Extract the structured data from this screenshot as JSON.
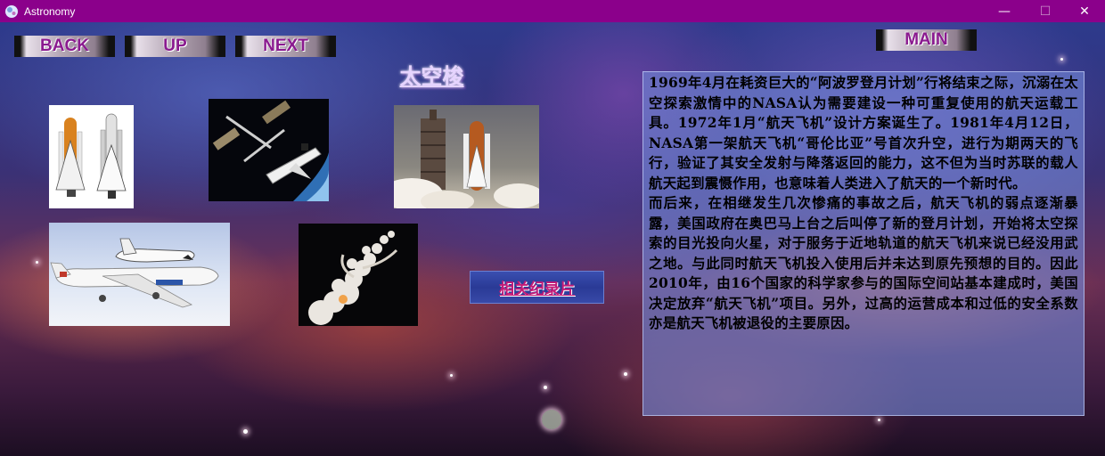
{
  "window": {
    "title": "Astronomy",
    "controls": {
      "minimize": "—",
      "maximize": "☐",
      "close": "✕"
    }
  },
  "nav": {
    "back": "BACK",
    "up": "UP",
    "next": "NEXT",
    "main": "MAIN"
  },
  "page": {
    "title": "太空梭",
    "documentary_link": "相关纪录片"
  },
  "photos": [
    {
      "name": "shuttle-stack-diagram-photo",
      "icon": "shuttle-icon"
    },
    {
      "name": "shuttle-docked-station-photo",
      "icon": "space-station-icon"
    },
    {
      "name": "shuttle-launch-photo",
      "icon": "rocket-launch-icon"
    },
    {
      "name": "shuttle-carrier-aircraft-photo",
      "icon": "airplane-icon"
    },
    {
      "name": "challenger-explosion-photo",
      "icon": "smoke-icon"
    }
  ],
  "article": {
    "paragraph1": "1969年4月在耗资巨大的“阿波罗登月计划”行将结束之际，沉溺在太空探索激情中的NASA认为需要建设一种可重复使用的航天运载工具。1972年1月“航天飞机”设计方案诞生了。1981年4月12日，NASA第一架航天飞机“哥伦比亚”号首次升空，进行为期两天的飞行，验证了其安全发射与降落返回的能力，这不但为当时苏联的载人航天起到震慑作用，也意味着人类进入了航天的一个新时代。",
    "paragraph2": "而后来，在相继发生几次惨痛的事故之后，航天飞机的弱点逐渐暴露，美国政府在奥巴马上台之后叫停了新的登月计划，开始将太空探索的目光投向火星，对于服务于近地轨道的航天飞机来说已经没用武之地。与此同时航天飞机投入使用后并未达到原先预想的目的。因此2010年，由16个国家的科学家参与的国际空间站基本建成时，美国决定放弃“航天飞机”项目。另外，过高的运营成本和过低的安全系数亦是航天飞机被退役的主要原因。"
  },
  "colors": {
    "titlebar": "#8b008b",
    "nav_text": "#8a1a8f",
    "link_text": "#c21b78",
    "panel": "#7387d7"
  }
}
